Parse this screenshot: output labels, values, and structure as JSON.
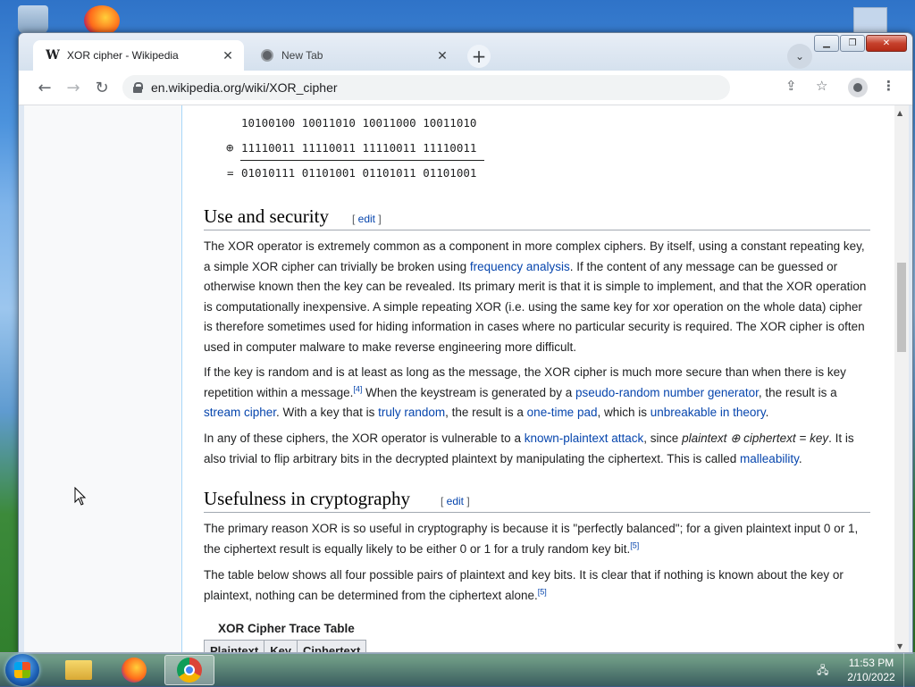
{
  "browser": {
    "tabs": [
      {
        "title": "XOR cipher - Wikipedia",
        "favicon": "W"
      },
      {
        "title": "New Tab"
      }
    ],
    "url": "en.wikipedia.org/wiki/XOR_cipher",
    "new_tab_symbol": "+",
    "tab_close_symbol": "✕"
  },
  "article": {
    "xor_example": {
      "row1": "10100100 10011010 10011000 10011010",
      "operator": "⊕",
      "row2": "11110011 11110011 11110011 11110011",
      "equals": "=",
      "result": "01010111 01101001 01101011 01101001"
    },
    "sections": [
      {
        "heading": "Use and security",
        "edit": "edit",
        "p1": {
          "t1": "The XOR operator is extremely common as a component in more complex ciphers. By itself, using a constant repeating key, a simple XOR cipher can trivially be broken using ",
          "l1": "frequency analysis",
          "t2": ". If the content of any message can be guessed or otherwise known then the key can be revealed. Its primary merit is that it is simple to implement, and that the XOR operation is computationally inexpensive. A simple repeating XOR (i.e. using the same key for xor operation on the whole data) cipher is therefore sometimes used for hiding information in cases where no particular security is required. The XOR cipher is often used in computer malware to make reverse engineering more difficult."
        },
        "p2": {
          "t1": "If the key is random and is at least as long as the message, the XOR cipher is much more secure than when there is key repetition within a message.",
          "ref1": "[4]",
          "t2": " When the keystream is generated by a ",
          "l1": "pseudo-random number generator",
          "t3": ", the result is a ",
          "l2": "stream cipher",
          "t4": ". With a key that is ",
          "l3": "truly random",
          "t5": ", the result is a ",
          "l4": "one-time pad",
          "t6": ", which is ",
          "l5": "unbreakable in theory",
          "t7": "."
        },
        "p3": {
          "t1": "In any of these ciphers, the XOR operator is vulnerable to a ",
          "l1": "known-plaintext attack",
          "t2": ", since ",
          "i1": "plaintext ⊕ ciphertext = key",
          "t3": ". It is also trivial to flip arbitrary bits in the decrypted plaintext by manipulating the ciphertext. This is called ",
          "l2": "malleability",
          "t4": "."
        }
      },
      {
        "heading": "Usefulness in cryptography",
        "edit": "edit",
        "p1": {
          "t1": "The primary reason XOR is so useful in cryptography is because it is \"perfectly balanced\"; for a given plaintext input 0 or 1, the ciphertext result is equally likely to be either 0 or 1 for a truly random key bit.",
          "ref1": "[5]"
        },
        "p2": {
          "t1": "The table below shows all four possible pairs of plaintext and key bits. It is clear that if nothing is known about the key or plaintext, nothing can be determined from the ciphertext alone.",
          "ref1": "[5]"
        }
      }
    ],
    "table": {
      "caption": "XOR Cipher Trace Table",
      "headers": [
        "Plaintext",
        "Key",
        "Ciphertext"
      ]
    }
  },
  "taskbar": {
    "time": "11:53 PM",
    "date": "2/10/2022"
  },
  "colors": {
    "link": "#0645ad",
    "text": "#202122"
  }
}
